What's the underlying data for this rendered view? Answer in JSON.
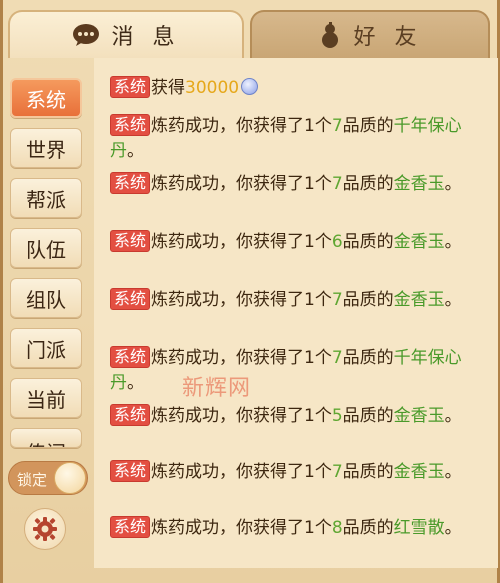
{
  "tabs": [
    {
      "label": "消 息",
      "icon": "chat-bubble-icon",
      "active": true
    },
    {
      "label": "好 友",
      "icon": "gourd-icon",
      "active": false
    }
  ],
  "sidebar": {
    "items": [
      {
        "label": "系统",
        "active": true
      },
      {
        "label": "世界"
      },
      {
        "label": "帮派"
      },
      {
        "label": "队伍"
      },
      {
        "label": "组队"
      },
      {
        "label": "门派"
      },
      {
        "label": "当前"
      },
      {
        "label": "传闻"
      }
    ],
    "lock_label": "锁定"
  },
  "messages": [
    {
      "tag": "系统",
      "pre": "获得",
      "gold": "30000",
      "post": "",
      "item": "",
      "coin": true
    },
    {
      "tag": "系统",
      "pre": "炼药成功，你获得了1个",
      "num": "7",
      "mid": "品质的",
      "item": "千年保心丹",
      "tail": "。"
    },
    {
      "tag": "系统",
      "pre": "炼药成功，你获得了1个",
      "num": "7",
      "mid": "品质的",
      "item": "金香玉",
      "tail": "。"
    },
    {
      "tag": "系统",
      "pre": "炼药成功，你获得了1个",
      "num": "6",
      "mid": "品质的",
      "item": "金香玉",
      "tail": "。"
    },
    {
      "tag": "系统",
      "pre": "炼药成功，你获得了1个",
      "num": "7",
      "mid": "品质的",
      "item": "金香玉",
      "tail": "。"
    },
    {
      "tag": "系统",
      "pre": "炼药成功，你获得了1个",
      "num": "7",
      "mid": "品质的",
      "item": "千年保心丹",
      "tail": "。"
    },
    {
      "tag": "系统",
      "pre": "炼药成功，你获得了1个",
      "num": "5",
      "mid": "品质的",
      "item": "金香玉",
      "tail": "。"
    },
    {
      "tag": "系统",
      "pre": "炼药成功，你获得了1个",
      "num": "7",
      "mid": "品质的",
      "item": "金香玉",
      "tail": "。"
    },
    {
      "tag": "系统",
      "pre": "炼药成功，你获得了1个",
      "num": "8",
      "mid": "品质的",
      "item": "红雪散",
      "tail": "。"
    }
  ],
  "watermark": "新辉网",
  "colors": {
    "tag_bg": "#e34f42",
    "gold": "#e6a81b",
    "item": "#4a9a2a",
    "active_tab": "#f08a50"
  }
}
